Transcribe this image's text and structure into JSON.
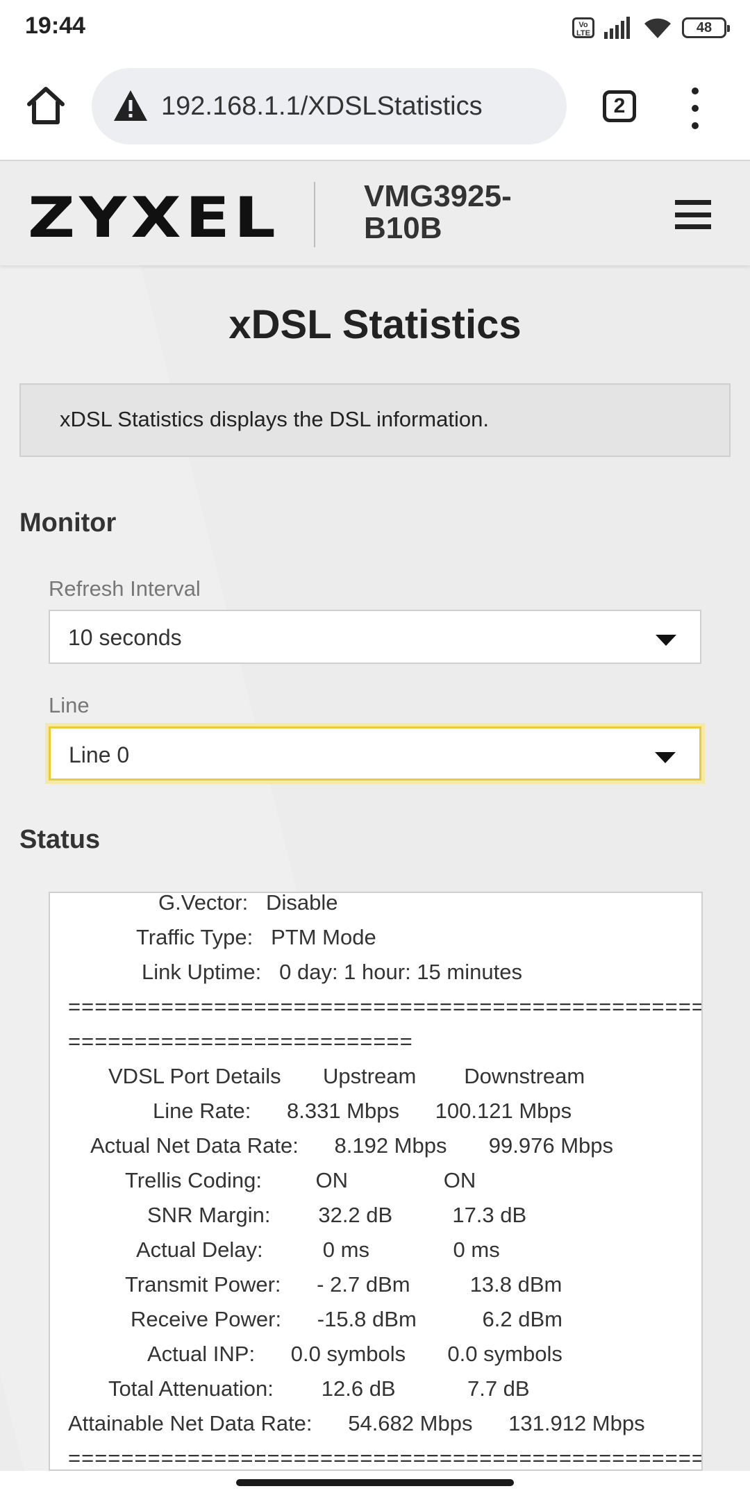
{
  "status_bar": {
    "time": "19:44",
    "volte_label": "Vo LTE",
    "battery": "48",
    "icons": [
      "volte-icon",
      "signal-icon",
      "wifi-icon",
      "battery-icon"
    ]
  },
  "browser": {
    "url": "192.168.1.1/XDSLStatistics",
    "tab_count": "2",
    "icons": [
      "home-icon",
      "warning-icon",
      "tabs-icon",
      "more-vert-icon"
    ]
  },
  "header": {
    "logo": "ZYXEL",
    "model_line1": "VMG3925-",
    "model_line2": "B10B",
    "menu_icon": "hamburger-icon"
  },
  "page": {
    "title": "xDSL Statistics",
    "description": "xDSL Statistics displays the DSL information."
  },
  "monitor": {
    "heading": "Monitor",
    "refresh_label": "Refresh Interval",
    "refresh_value": "10 seconds",
    "line_label": "Line",
    "line_value": "Line 0"
  },
  "status": {
    "heading": "Status",
    "lines": [
      "G.Vector:   Disable",
      "Traffic Type:   PTM Mode",
      "Link Uptime:   0 day: 1 hour: 15 minutes",
      "================================================",
      "==========================",
      "VDSL Port Details       Upstream        Downstream",
      "Line Rate:      8.331 Mbps      100.121 Mbps",
      "Actual Net Data Rate:      8.192 Mbps       99.976 Mbps",
      "Trellis Coding:         ON                ON",
      "SNR Margin:        32.2 dB          17.3 dB",
      "Actual Delay:          0 ms              0 ms",
      "Transmit Power:      - 2.7 dBm          13.8 dBm",
      "Receive Power:      -15.8 dBm           6.2 dBm",
      "Actual INP:      0.0 symbols       0.0 symbols",
      "Total Attenuation:        12.6 dB            7.7 dB",
      "Attainable Net Data Rate:      54.682 Mbps      131.912 Mbps",
      "================================================ ."
    ]
  }
}
